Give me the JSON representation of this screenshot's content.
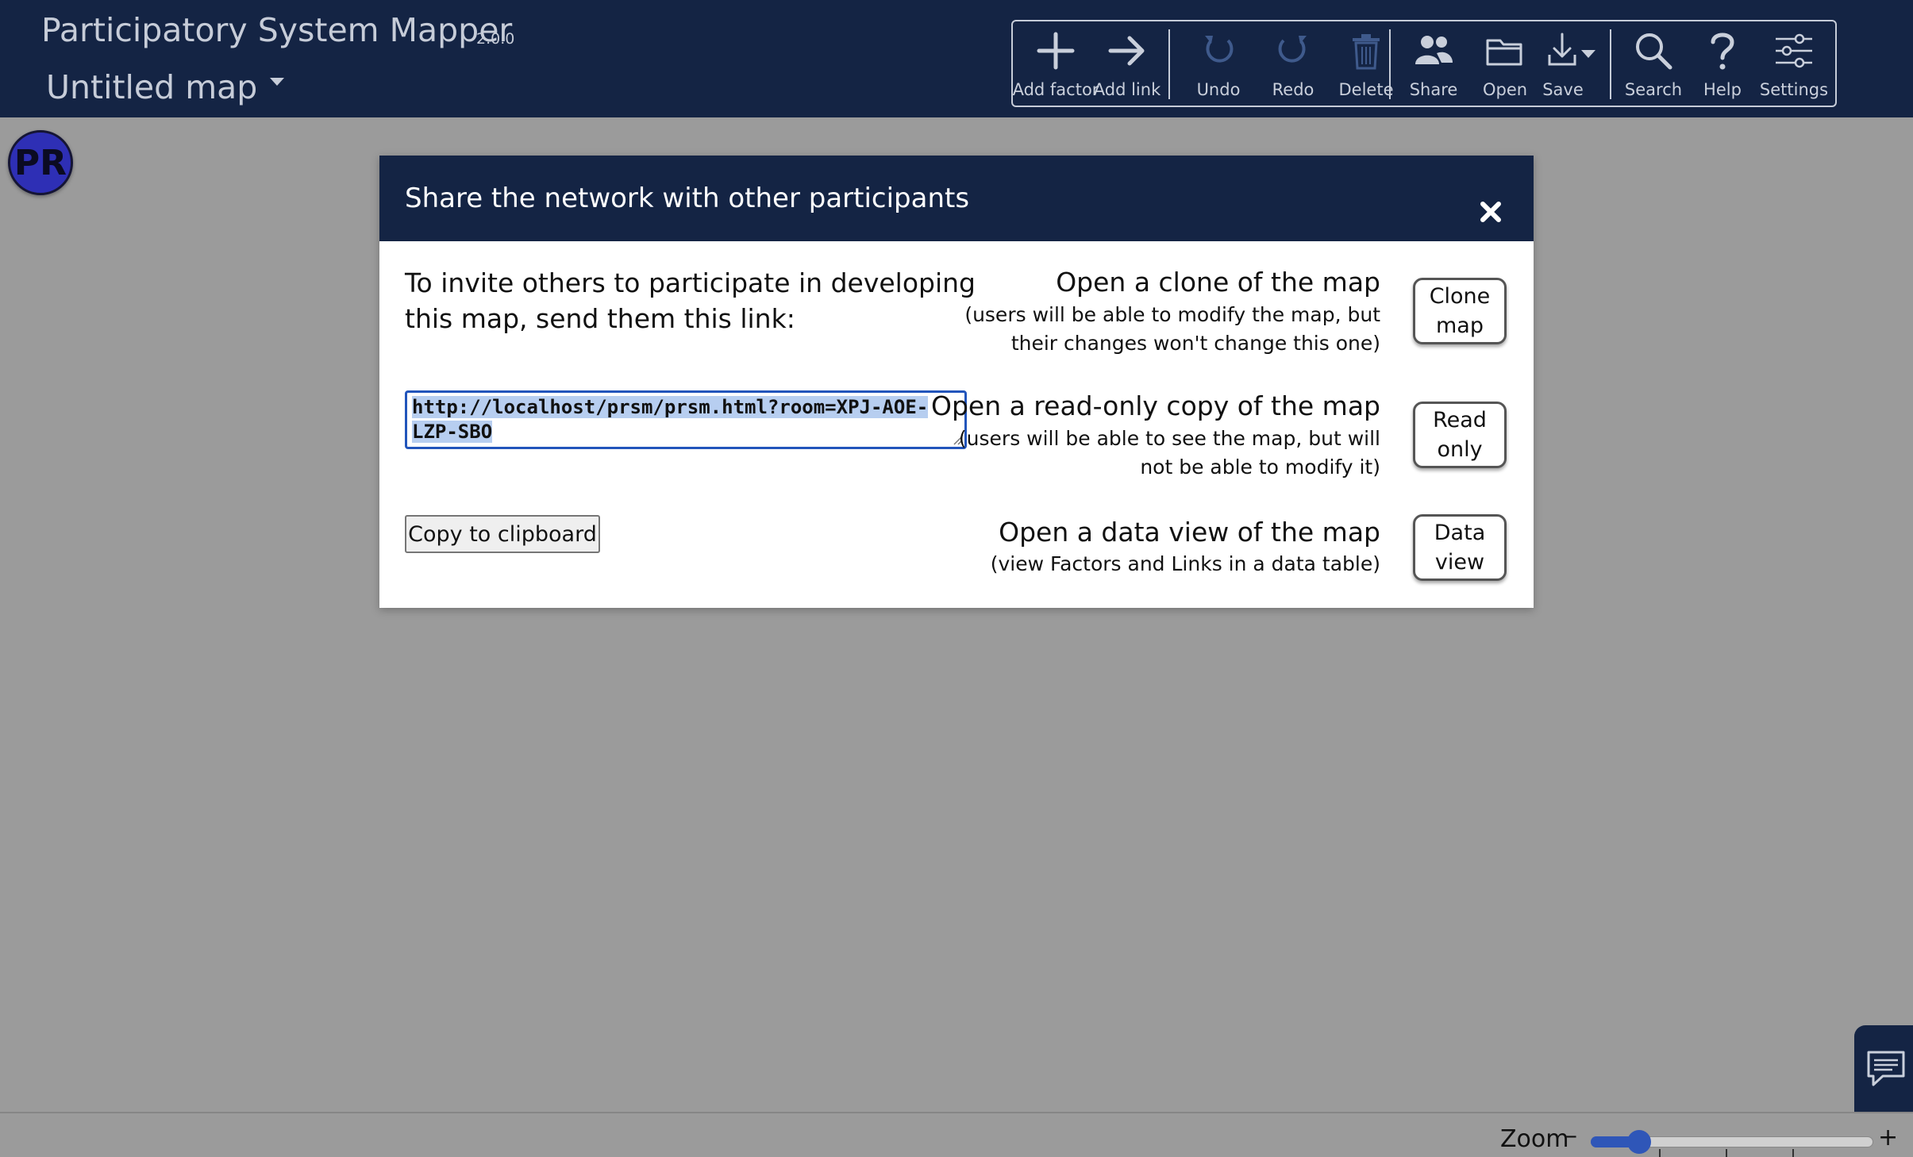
{
  "app": {
    "title": "Participatory System Mapper",
    "version": "2.0.0",
    "map_title": "Untitled map"
  },
  "toolbar": {
    "add_factor": "Add factor",
    "add_link": "Add link",
    "undo": "Undo",
    "redo": "Redo",
    "delete": "Delete",
    "share": "Share",
    "open": "Open",
    "save": "Save",
    "search": "Search",
    "help": "Help",
    "settings": "Settings"
  },
  "avatar": {
    "initials": "PR",
    "color": "#2e2fb5"
  },
  "dialog": {
    "title": "Share the network with other participants",
    "invite_text": "To invite others to participate in developing this map, send them this link:",
    "link": "http://localhost/prsm/prsm.html?room=XPJ-AOE-LZP-SBO",
    "copy_label": "Copy to clipboard",
    "options": [
      {
        "title": "Open a clone of the map",
        "desc_line1": "(users will be able to modify the map, but",
        "desc_line2": "their changes won't change this one)",
        "button": "Clone map"
      },
      {
        "title": "Open a read-only copy of the map",
        "desc_line1": "(users will be able to see the map, but will",
        "desc_line2": "not be able to modify it)",
        "button": "Read only"
      },
      {
        "title": "Open a data view of the map",
        "desc_line1": "(view Factors and Links in a data table)",
        "button": "Data view"
      }
    ]
  },
  "zoom": {
    "label": "Zoom",
    "minus": "–",
    "plus": "+",
    "value_fraction": 0.17
  },
  "colors": {
    "header_bg": "#142444",
    "canvas_bg": "#9b9b9b",
    "accent": "#2f56b8",
    "disabled_icon": "#3f5a8c"
  },
  "icons": [
    "plus-icon",
    "arrow-right-icon",
    "undo-icon",
    "redo-icon",
    "trash-icon",
    "users-icon",
    "folder-icon",
    "download-icon",
    "search-icon",
    "question-icon",
    "sliders-icon",
    "close-icon",
    "chat-icon"
  ]
}
